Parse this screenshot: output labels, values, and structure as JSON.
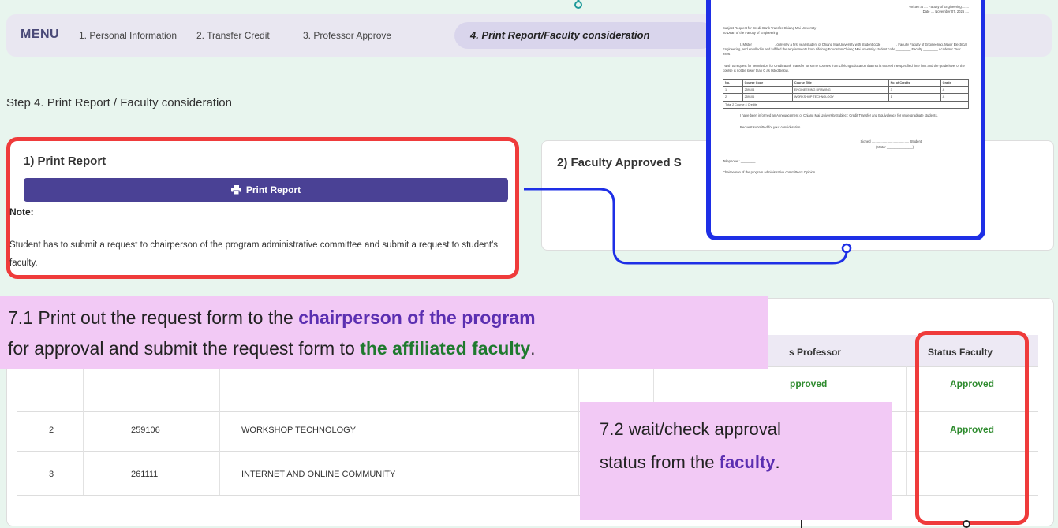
{
  "menu": {
    "title": "MENU",
    "items": [
      "1. Personal Information",
      "2. Transfer Credit",
      "3. Professor Approve"
    ],
    "active": "4. Print Report/Faculty consideration"
  },
  "step_title": "Step 4. Print Report / Faculty consideration",
  "card1": {
    "title": "1) Print Report",
    "button": "Print Report",
    "note_label": "Note:",
    "note_text": "Student has to submit a request to chairperson of the program administrative committee and submit a request to student's faculty."
  },
  "card2": {
    "title": "2) Faculty Approved S"
  },
  "document": {
    "header_line1": "Written at .... Faculty of Engineering........",
    "header_line2": "Date .... November 07, 2025 ....",
    "subject": "Subject   Request for Credit Bank Transfer Chiang Mai University",
    "to": "To   Dean of the Faculty of Engineering",
    "body1": "I, Mister ____________, currently a first year student of Chiang Mai University with student code ________, Faculty Faculty of Engineering, Major Electrical Engineering, and enrolled in and fulfilled the requirements from Lifelong Education Chiang Mai university student code ________ Faculty ________ Academic Year 2025",
    "body2": "I wish to request for permission for Credit Bank Transfer for some courses from Lifelong Education that not is exceed the specified time limit and the grade level of the course is not be lower than C as listed below.",
    "table_headers": [
      "No.",
      "Course Code",
      "Course Title",
      "No. of Credits",
      "Grade"
    ],
    "table_rows": [
      [
        "1",
        "259104",
        "ENGINEERING DRAWING",
        "3",
        "A"
      ],
      [
        "2",
        "259106",
        "WORKSHOP TECHNOLOGY",
        "1",
        "A"
      ]
    ],
    "table_total": "Total   2   Course   4   Credits",
    "body3": "I have been informed an Announcement of Chiang Mai University Subject: Credit Transfer and Equivalence for undergraduate students.",
    "body4": "Request submitted for your consideration.",
    "signed": "Signed ......................................... Student",
    "signed_name": "(Mister ______________)",
    "telephone": "Telephone : ________",
    "chair": "Chairperson of the program administrative committee's Opinion"
  },
  "table": {
    "headers": [
      "s Professor",
      "Status Faculty"
    ],
    "rows": [
      {
        "no": "",
        "code": "",
        "title": "",
        "prof": "pproved",
        "faculty": "Approved"
      },
      {
        "no": "2",
        "code": "259106",
        "title": "WORKSHOP TECHNOLOGY",
        "prof": "",
        "faculty": "Approved"
      },
      {
        "no": "3",
        "code": "261111",
        "title": "INTERNET AND ONLINE COMMUNITY",
        "prof": "",
        "faculty": ""
      }
    ]
  },
  "callout1": {
    "t1": "7.1 Print out the request form to the ",
    "t2": "chairperson of the program",
    "t3": "for approval and submit the request form to ",
    "t4": "the affiliated faculty",
    "t5": "."
  },
  "callout2": {
    "t1": "7.2 wait/check approval",
    "t2": "status from the ",
    "t3": "faculty",
    "t4": "."
  },
  "colors": {
    "accent": "#4a4195",
    "highlight_red": "#ef3b3b",
    "connector_blue": "#1e2fe6",
    "approved_green": "#2e8b2e",
    "callout_pink": "#f2c9f5"
  }
}
